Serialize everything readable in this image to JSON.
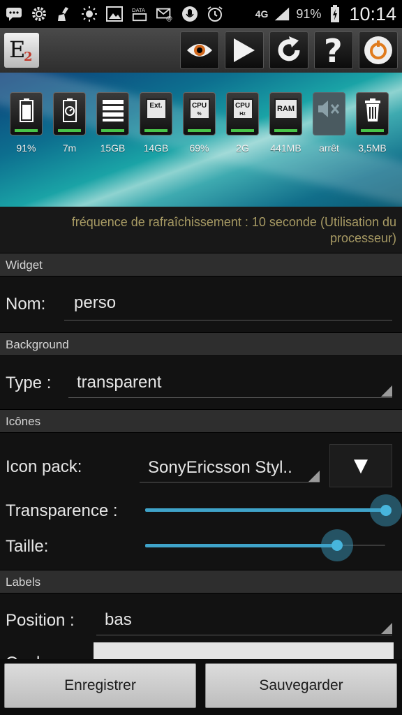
{
  "status_bar": {
    "network": "4G",
    "battery_percent": "91%",
    "time": "10:14",
    "icons": [
      "sms-icon",
      "settings-icon",
      "cleaning-icon",
      "brightness-icon",
      "gallery-icon",
      "data-icon",
      "mail-icon",
      "mic-icon",
      "alarm-icon"
    ]
  },
  "app_bar": {
    "logo_letter": "E",
    "logo_sub": "2",
    "buttons": [
      "eye-icon",
      "play-icon",
      "refresh-icon",
      "help-icon",
      "power-icon"
    ]
  },
  "widget_preview": {
    "items": [
      {
        "icon": "battery-icon",
        "label": "91%"
      },
      {
        "icon": "battery-timer-icon",
        "label": "7m"
      },
      {
        "icon": "storage-icon",
        "label": "15GB"
      },
      {
        "icon": "sd-card-icon",
        "label": "14GB",
        "chip": "Ext."
      },
      {
        "icon": "cpu-percent-icon",
        "label": "69%",
        "chip": "CPU",
        "sub": "%"
      },
      {
        "icon": "cpu-frequency-icon",
        "label": "2G",
        "chip": "CPU",
        "sub": "Hz"
      },
      {
        "icon": "ram-icon",
        "label": "441MB",
        "chip": "RAM"
      },
      {
        "icon": "sound-muted-icon",
        "label": "arrêt"
      },
      {
        "icon": "trash-icon",
        "label": "3,5MB"
      }
    ]
  },
  "refresh_info": "fréquence de rafraîchissement : 10 seconde (Utilisation du processeur)",
  "sections": {
    "widget": {
      "header": "Widget",
      "name_label": "Nom:",
      "name_value": "perso"
    },
    "background": {
      "header": "Background",
      "type_label": "Type :",
      "type_value": "transparent"
    },
    "icons": {
      "header": "Icônes",
      "pack_label": "Icon pack:",
      "pack_value": "SonyEricsson Styl..",
      "dropdown_glyph": "▼",
      "transparency_label": "Transparence :",
      "transparency_level": 1.0,
      "size_label": "Taille:",
      "size_level": 0.8
    },
    "labels": {
      "header": "Labels",
      "position_label": "Position :",
      "position_value": "bas",
      "color_label_partial": "Couleur"
    }
  },
  "buttons": {
    "register": "Enregistrer",
    "save": "Sauvegarder"
  }
}
